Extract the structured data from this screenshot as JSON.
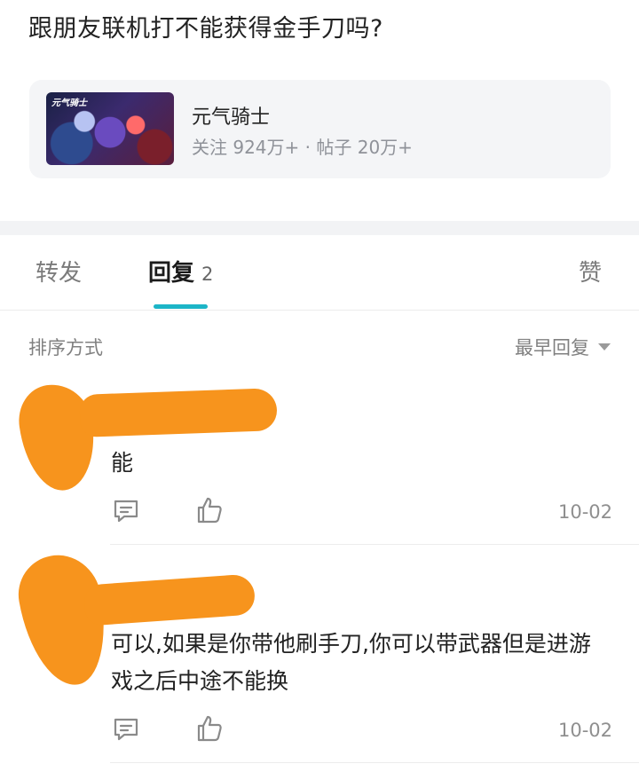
{
  "post": {
    "title": "跟朋友联机打不能获得金手刀吗?"
  },
  "forum": {
    "thumb_text": "元气骑士",
    "name": "元气骑士",
    "stats": "关注 924万+ · 帖子 20万+"
  },
  "tabs": [
    {
      "label": "转发",
      "count": ""
    },
    {
      "label": "回复",
      "count": "2"
    },
    {
      "label": "赞",
      "count": ""
    }
  ],
  "sort": {
    "label": "排序方式",
    "selected": "最早回复"
  },
  "replies": [
    {
      "text": "能",
      "date": "10-02"
    },
    {
      "text": "可以,如果是你带他刷手刀,你可以带武器但是进游戏之后中途不能换",
      "date": "10-02"
    }
  ],
  "colors": {
    "accent": "#1cb5c7",
    "redaction": "#f7941d"
  },
  "icons": {
    "comment": "comment-icon",
    "like": "thumbs-up-icon",
    "dropdown": "caret-down-icon"
  }
}
